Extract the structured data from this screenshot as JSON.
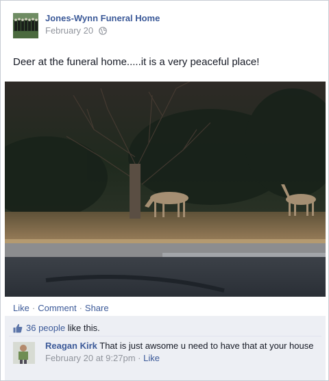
{
  "post": {
    "page_name": "Jones-Wynn Funeral Home",
    "date": "February 20",
    "privacy_icon": "globe-icon",
    "text": "Deer at the funeral home.....it is a very peaceful place!",
    "photo_icon": "photo-deer"
  },
  "actions": {
    "like": "Like",
    "comment": "Comment",
    "share": "Share",
    "separator": "·"
  },
  "likes": {
    "icon": "thumbs-up-icon",
    "count_text": "36 people",
    "suffix": " like this."
  },
  "comment": {
    "author": "Reagan Kirk",
    "text": " That is just awsome u need to have that at your house",
    "timestamp": "February 20 at 9:27pm",
    "separator": " · ",
    "like": "Like"
  },
  "colors": {
    "link": "#3b5998",
    "meta": "#90949c",
    "feedback_bg": "#edeff4"
  }
}
